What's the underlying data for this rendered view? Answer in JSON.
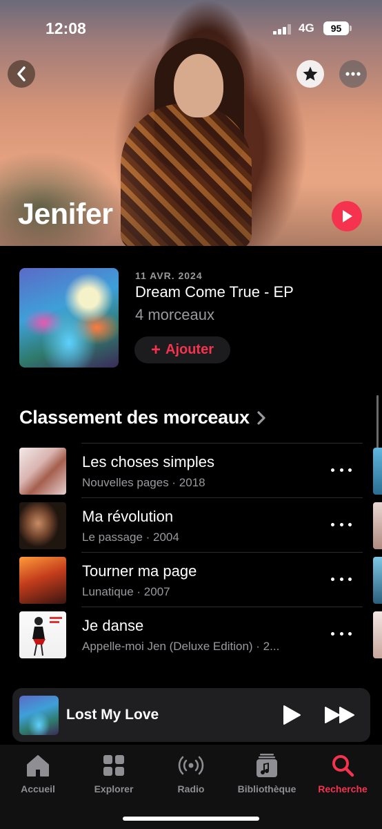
{
  "status_bar": {
    "time": "12:08",
    "network": "4G",
    "battery": "95"
  },
  "artist": {
    "name": "Jenifer"
  },
  "latest_release": {
    "date": "11 AVR. 2024",
    "title": "Dream Come True - EP",
    "track_count": "4 morceaux",
    "add_label": "Ajouter"
  },
  "top_songs": {
    "title": "Classement des morceaux",
    "songs": [
      {
        "title": "Les choses simples",
        "subtitle": "Nouvelles pages · 2018"
      },
      {
        "title": "Ma révolution",
        "subtitle": "Le passage · 2004"
      },
      {
        "title": "Tourner ma page",
        "subtitle": "Lunatique · 2007"
      },
      {
        "title": "Je danse",
        "subtitle": "Appelle-moi Jen (Deluxe Edition) · 2..."
      }
    ]
  },
  "mini_player": {
    "title": "Lost My Love"
  },
  "tab_bar": {
    "tabs": [
      {
        "label": "Accueil",
        "icon": "home-icon"
      },
      {
        "label": "Explorer",
        "icon": "grid-icon"
      },
      {
        "label": "Radio",
        "icon": "radio-icon"
      },
      {
        "label": "Bibliothèque",
        "icon": "library-icon"
      },
      {
        "label": "Recherche",
        "icon": "search-icon"
      }
    ],
    "active": "Recherche"
  },
  "colors": {
    "accent": "#f5334f",
    "background": "#000000",
    "secondary_text": "#9a9a9e"
  }
}
